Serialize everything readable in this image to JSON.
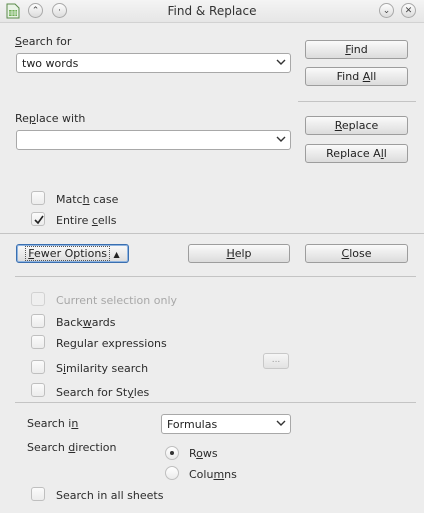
{
  "window": {
    "title": "Find & Replace"
  },
  "search": {
    "label": "Search for",
    "value": "two words",
    "find_label": "Find",
    "find_all_label": "Find All"
  },
  "replace": {
    "label": "Replace with",
    "value": "",
    "replace_label": "Replace",
    "replace_all_label": "Replace All"
  },
  "basic_options": {
    "match_case": {
      "label": "Match case",
      "checked": false
    },
    "entire_cells": {
      "label": "Entire cells",
      "checked": true
    }
  },
  "buttons": {
    "fewer_options": "Fewer Options",
    "help": "Help",
    "close": "Close"
  },
  "other_options": {
    "current_selection": {
      "label": "Current selection only",
      "checked": false,
      "disabled": true
    },
    "backwards": {
      "label": "Backwards",
      "checked": false
    },
    "regex": {
      "label": "Regular expressions",
      "checked": false
    },
    "similarity": {
      "label": "Similarity search",
      "checked": false,
      "button_label": "..."
    },
    "styles": {
      "label": "Search for Styles",
      "checked": false
    }
  },
  "search_in": {
    "label": "Search in",
    "value": "Formulas"
  },
  "direction": {
    "label": "Search direction",
    "rows": {
      "label": "Rows",
      "selected": true
    },
    "columns": {
      "label": "Columns",
      "selected": false
    }
  },
  "all_sheets": {
    "label": "Search in all sheets",
    "checked": false
  }
}
